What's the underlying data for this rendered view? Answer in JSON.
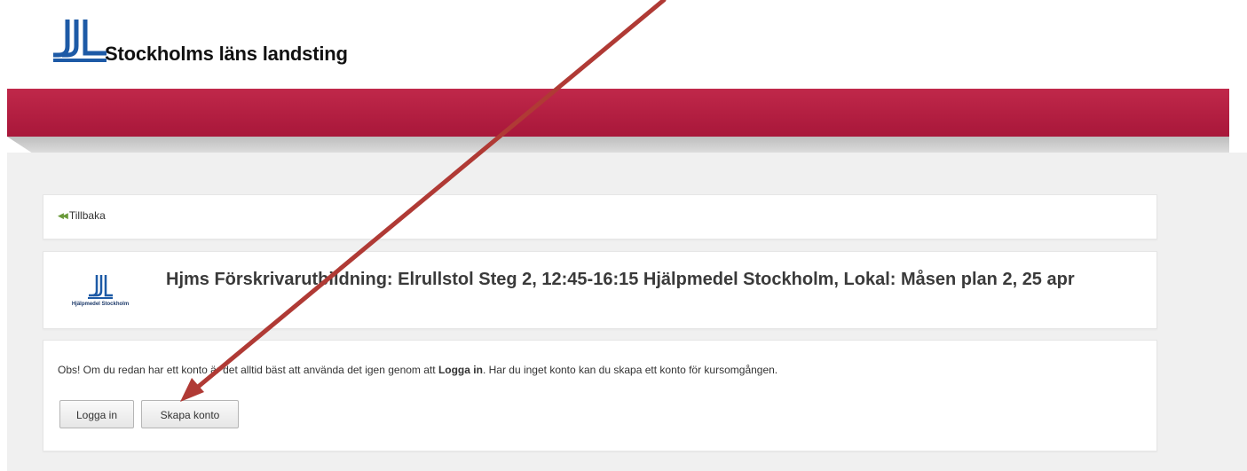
{
  "header": {
    "org_name": "Stockholms läns landsting",
    "brand_color": "#b5183f"
  },
  "nav": {
    "back_label": "Tillbaka",
    "back_icon": "double-left-arrow-icon"
  },
  "course": {
    "logo_text": "Hjälpmedel Stockholm",
    "title": "Hjms Förskrivarutbildning: Elrullstol Steg 2, 12:45-16:15 Hjälpmedel Stockholm, Lokal: Måsen plan 2, 25 apr"
  },
  "login": {
    "notice_before": "Obs! Om du redan har ett konto är det alltid bäst att använda det igen genom att ",
    "notice_bold": "Logga in",
    "notice_after": ". Har du inget konto kan du skapa ett konto för kursomgången.",
    "login_button": "Logga in",
    "create_button": "Skapa konto"
  },
  "annotation": {
    "arrow_color": "#b03a35"
  }
}
